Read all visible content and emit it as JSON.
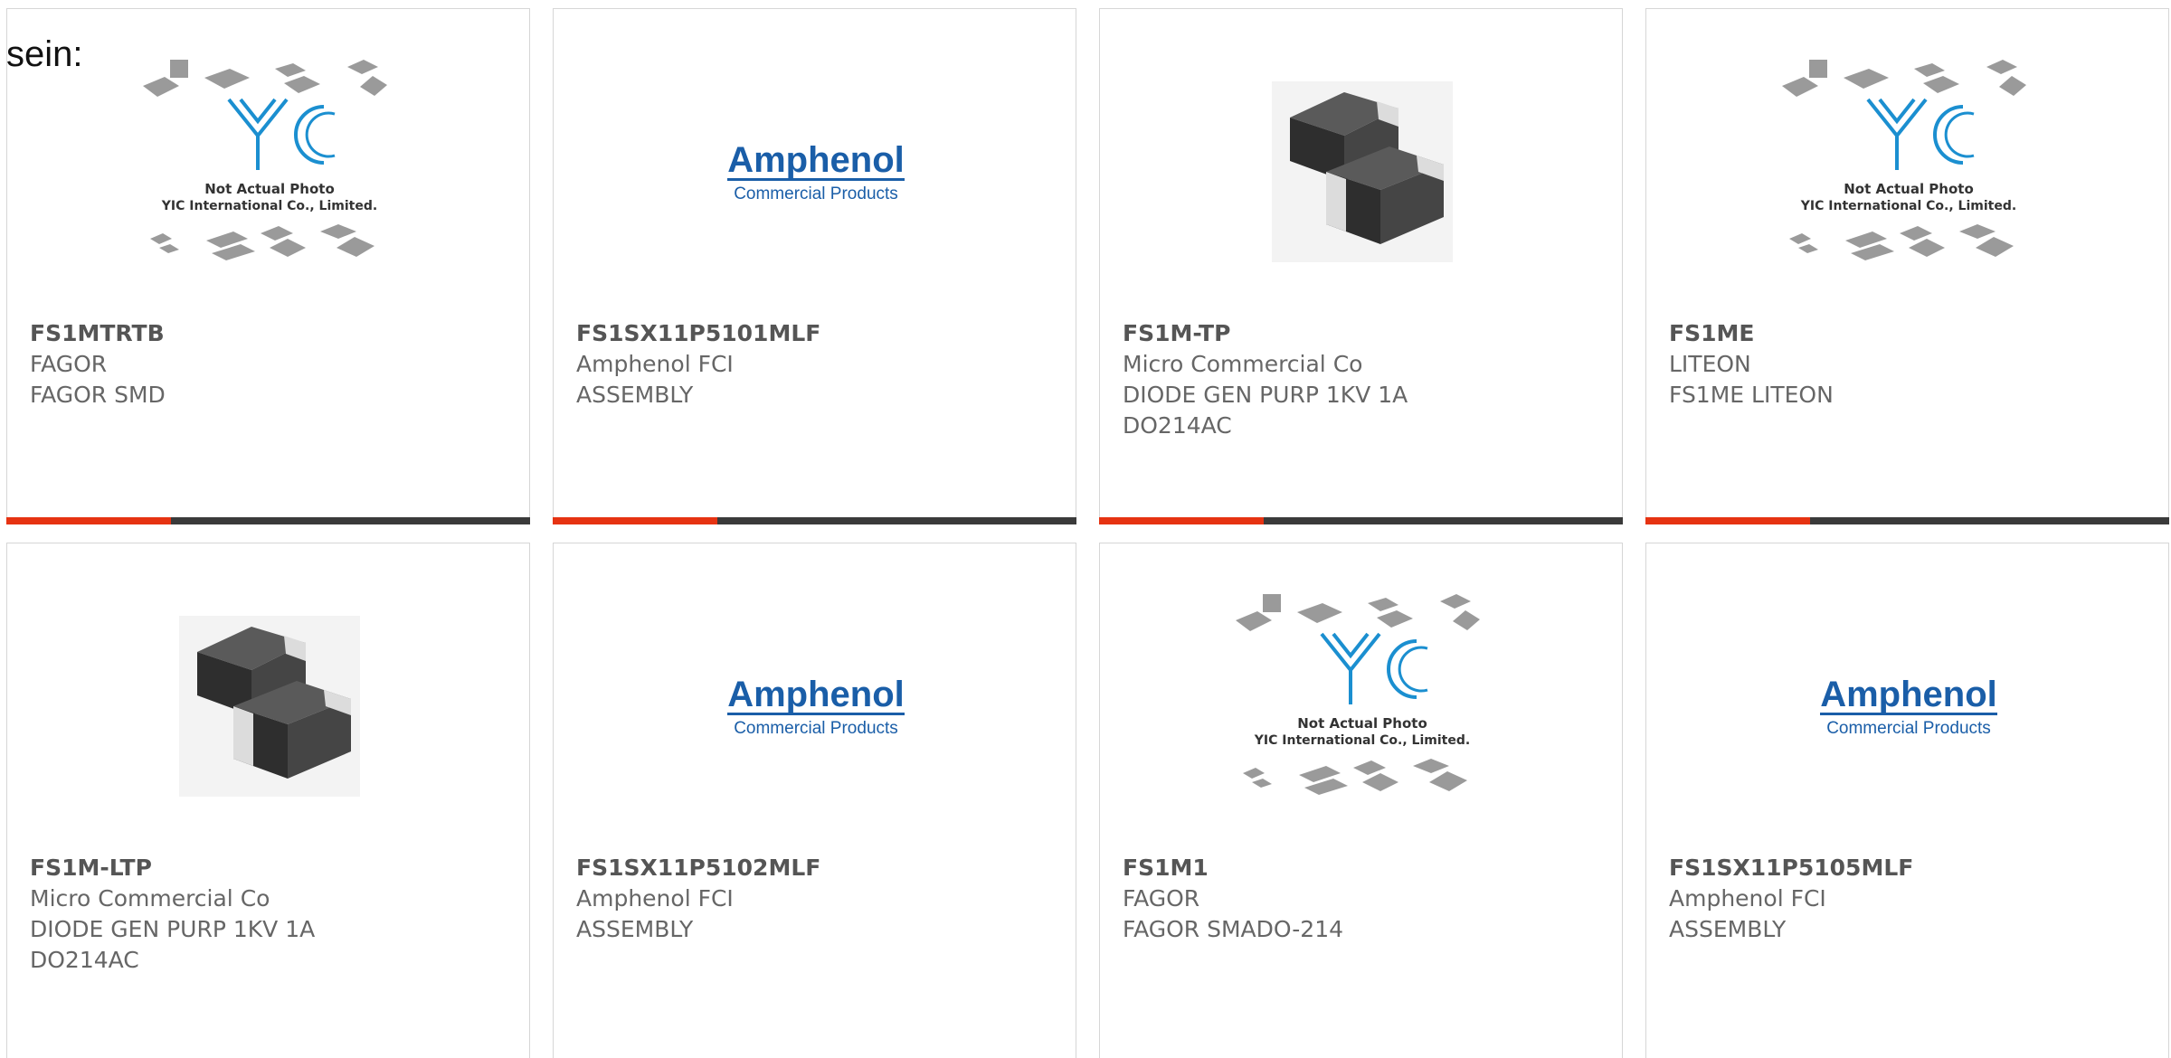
{
  "page": {
    "lead_text": "sein:"
  },
  "placeholder_image": {
    "line1": "Not Actual Photo",
    "line2": "YIC International Co., Limited.",
    "logo": "YIC"
  },
  "amphenol_logo": {
    "name": "Amphenol",
    "tagline": "Commercial Products"
  },
  "products": [
    {
      "part": "FS1MTRTB",
      "maker": "FAGOR",
      "desc": [
        "FAGOR SMD"
      ],
      "image": "yic-placeholder-image"
    },
    {
      "part": "FS1SX11P5101MLF",
      "maker": "Amphenol FCI",
      "desc": [
        "ASSEMBLY"
      ],
      "image": "amphenol-logo-image"
    },
    {
      "part": "FS1M-TP",
      "maker": "Micro Commercial Co",
      "desc": [
        "DIODE GEN PURP 1KV 1A",
        "DO214AC"
      ],
      "image": "smd-diode-photo"
    },
    {
      "part": "FS1ME",
      "maker": "LITEON",
      "desc": [
        "FS1ME LITEON"
      ],
      "image": "yic-placeholder-image"
    },
    {
      "part": "FS1M-LTP",
      "maker": "Micro Commercial Co",
      "desc": [
        "DIODE GEN PURP 1KV 1A",
        "DO214AC"
      ],
      "image": "smd-diode-photo"
    },
    {
      "part": "FS1SX11P5102MLF",
      "maker": "Amphenol FCI",
      "desc": [
        "ASSEMBLY"
      ],
      "image": "amphenol-logo-image"
    },
    {
      "part": "FS1M1",
      "maker": "FAGOR",
      "desc": [
        "FAGOR SMADO-214"
      ],
      "image": "yic-placeholder-image"
    },
    {
      "part": "FS1SX11P5105MLF",
      "maker": "Amphenol FCI",
      "desc": [
        "ASSEMBLY"
      ],
      "image": "amphenol-logo-image"
    }
  ],
  "colors": {
    "accent": "#e63312",
    "bar": "#3a3a3a",
    "amphenol_blue": "#1a5ea8",
    "yic_blue": "#1b8fd0"
  }
}
